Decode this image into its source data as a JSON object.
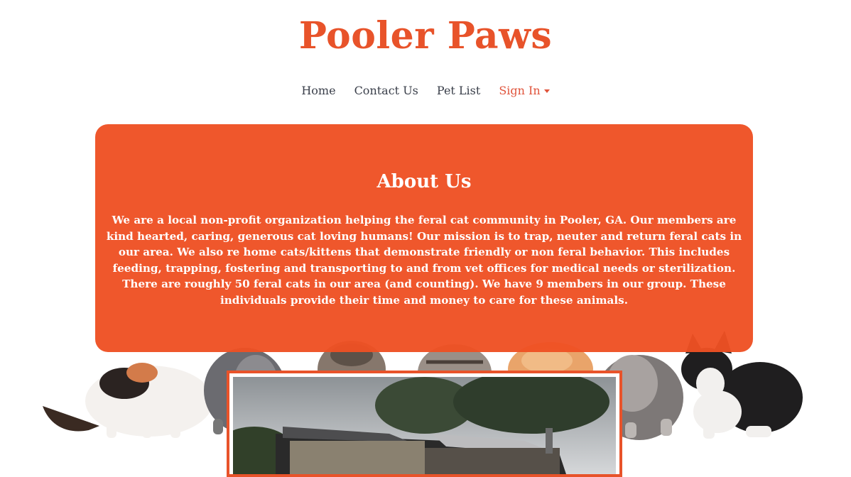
{
  "header": {
    "title": "Pooler Paws"
  },
  "nav": {
    "items": [
      {
        "label": "Home"
      },
      {
        "label": "Contact Us"
      },
      {
        "label": "Pet List"
      },
      {
        "label": "Sign In"
      }
    ]
  },
  "about": {
    "heading": "About Us",
    "body": "We are a local non-profit organization helping the feral cat community in Pooler, GA. Our members are kind hearted, caring, generous cat loving humans! Our mission is to trap, neuter and return feral cats in our area. We also re home cats/kittens that demonstrate friendly or non feral behavior. This includes feeding, trapping, fostering and transporting to and from vet offices for medical needs or sterilization. There are roughly 50 feral cats in our area (and counting). We have 9 members in our group. These individuals provide their time and money to care for these animals."
  },
  "colors": {
    "brand": "#e8532a",
    "panel": "#ee5023",
    "nav_text": "#3a3f4a",
    "signin": "#e0533b"
  },
  "icons": {
    "signin_caret": "chevron-down-icon"
  }
}
